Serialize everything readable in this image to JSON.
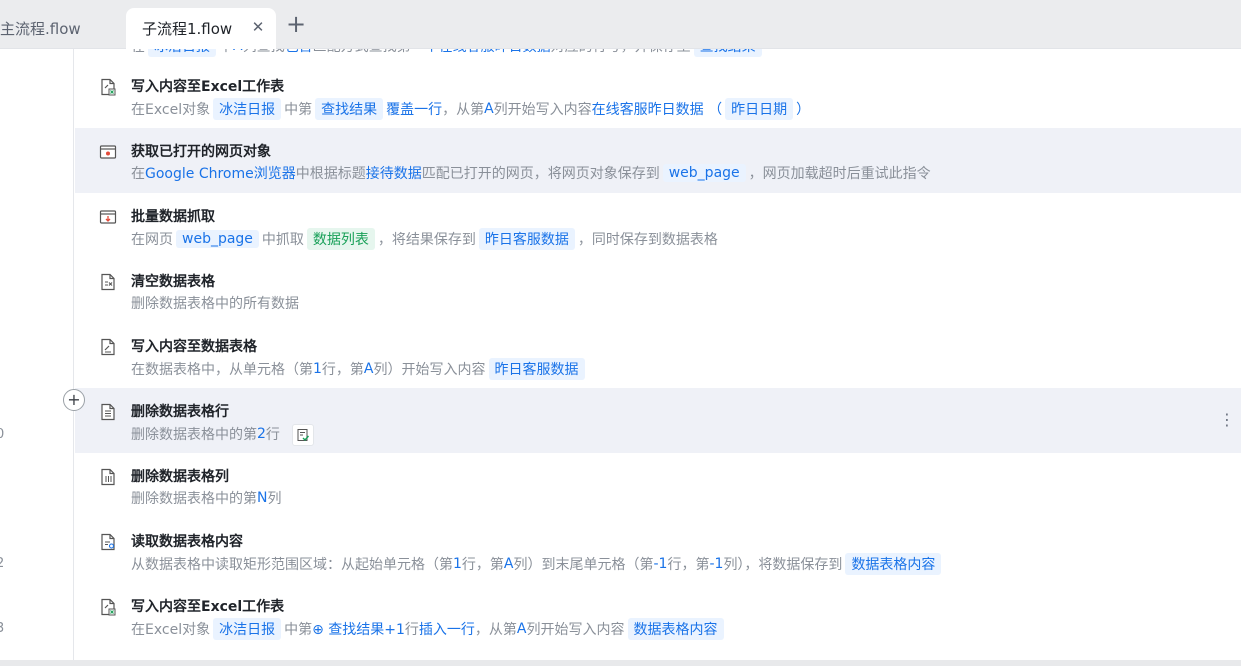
{
  "tabs": {
    "inactive_label": "主流程.flow",
    "active_label": "子流程1.flow",
    "close_glyph": "✕",
    "add_glyph": "+"
  },
  "gutter": {
    "line_numbers": [
      "0",
      "2",
      "3"
    ],
    "add_glyph": "+"
  },
  "steps": [
    {
      "title": "写入内容至Excel工作表",
      "icon": "excel-write-icon",
      "desc": [
        {
          "t": "t",
          "v": "在Excel对象"
        },
        {
          "t": "chip",
          "v": "冰洁日报"
        },
        {
          "t": "t",
          "v": "中第"
        },
        {
          "t": "chip",
          "v": "查找结果"
        },
        {
          "t": "k",
          "v": "覆盖一行"
        },
        {
          "t": "t",
          "v": "，从第 "
        },
        {
          "t": "k",
          "v": "A"
        },
        {
          "t": "t",
          "v": " 列开始写入内容 "
        },
        {
          "t": "k",
          "v": "在线客服昨日数据 （"
        },
        {
          "t": "chip",
          "v": "昨日日期"
        },
        {
          "t": "k",
          "v": "）"
        }
      ]
    },
    {
      "title": "获取已打开的网页对象",
      "icon": "browser-window-icon",
      "highlight": true,
      "desc": [
        {
          "t": "t",
          "v": "在 "
        },
        {
          "t": "k",
          "v": "Google Chrome浏览器"
        },
        {
          "t": "t",
          "v": " 中根据标题 "
        },
        {
          "t": "k",
          "v": "接待数据"
        },
        {
          "t": "t",
          "v": " 匹配已打开的网页，将网页对象保存到"
        },
        {
          "t": "chip",
          "v": " web_page "
        },
        {
          "t": "t",
          "v": "，网页加载超时后重试此指令"
        }
      ]
    },
    {
      "title": "批量数据抓取",
      "icon": "data-scrape-icon",
      "desc": [
        {
          "t": "t",
          "v": "在网页"
        },
        {
          "t": "chip",
          "v": " web_page "
        },
        {
          "t": "t",
          "v": "中抓取"
        },
        {
          "t": "chip-g",
          "v": "数据列表"
        },
        {
          "t": "t",
          "v": "，将结果保存到"
        },
        {
          "t": "chip",
          "v": "昨日客服数据"
        },
        {
          "t": "t",
          "v": "，同时保存到数据表格"
        }
      ]
    },
    {
      "title": "清空数据表格",
      "icon": "table-clear-icon",
      "desc": [
        {
          "t": "t",
          "v": "删除数据表格中的所有数据"
        }
      ]
    },
    {
      "title": "写入内容至数据表格",
      "icon": "table-write-icon",
      "desc": [
        {
          "t": "t",
          "v": "在数据表格中，从单元格（第 "
        },
        {
          "t": "k",
          "v": "1"
        },
        {
          "t": "t",
          "v": " 行，第 "
        },
        {
          "t": "k",
          "v": "A"
        },
        {
          "t": "t",
          "v": " 列）开始写入内容"
        },
        {
          "t": "chip",
          "v": "昨日客服数据"
        }
      ]
    },
    {
      "title": "删除数据表格行",
      "icon": "table-delete-row-icon",
      "highlight": true,
      "kebab": "⋮",
      "badge": true,
      "desc": [
        {
          "t": "t",
          "v": "删除数据表格中的第 "
        },
        {
          "t": "k",
          "v": "2"
        },
        {
          "t": "t",
          "v": " 行"
        }
      ]
    },
    {
      "title": "删除数据表格列",
      "icon": "table-delete-column-icon",
      "desc": [
        {
          "t": "t",
          "v": "删除数据表格中的第 "
        },
        {
          "t": "k",
          "v": "N"
        },
        {
          "t": "t",
          "v": " 列"
        }
      ]
    },
    {
      "title": "读取数据表格内容",
      "icon": "table-read-icon",
      "desc": [
        {
          "t": "t",
          "v": "从数据表格中读取矩形范围区域：从起始单元格（第 "
        },
        {
          "t": "k",
          "v": "1"
        },
        {
          "t": "t",
          "v": " 行，第 "
        },
        {
          "t": "k",
          "v": "A"
        },
        {
          "t": "t",
          "v": " 列）到末尾单元格（第 "
        },
        {
          "t": "k",
          "v": "-1"
        },
        {
          "t": "t",
          "v": " 行，第 "
        },
        {
          "t": "k",
          "v": "-1"
        },
        {
          "t": "t",
          "v": " 列），将数据保存到"
        },
        {
          "t": "chip",
          "v": "数据表格内容"
        }
      ]
    },
    {
      "title": "写入内容至Excel工作表",
      "icon": "excel-write-icon",
      "desc": [
        {
          "t": "t",
          "v": "在Excel对象"
        },
        {
          "t": "chip",
          "v": "冰洁日报"
        },
        {
          "t": "t",
          "v": "中第 "
        },
        {
          "t": "k",
          "v": "⊕ 查找结果+1"
        },
        {
          "t": "t",
          "v": "行 "
        },
        {
          "t": "k",
          "v": "插入一行"
        },
        {
          "t": "t",
          "v": "，从第 "
        },
        {
          "t": "k",
          "v": "A"
        },
        {
          "t": "t",
          "v": " 列开始写入内容"
        },
        {
          "t": "chip",
          "v": "数据表格内容"
        }
      ]
    }
  ],
  "cut_step": {
    "desc": [
      {
        "t": "t",
        "v": "在"
      },
      {
        "t": "chip",
        "v": "冰洁日报"
      },
      {
        "t": "t",
        "v": "中"
      },
      {
        "t": "k",
        "v": "A"
      },
      {
        "t": "t",
        "v": "列查找"
      },
      {
        "t": "k",
        "v": "包含"
      },
      {
        "t": "t",
        "v": "匹配方式查找第"
      },
      {
        "t": "k",
        "v": "一个"
      },
      {
        "t": "k",
        "v": "在线客服昨日数据"
      },
      {
        "t": "t",
        "v": "对应的行号，并保存至"
      },
      {
        "t": "chip",
        "v": "查找结果"
      }
    ]
  },
  "colors": {
    "keyword": "#1a73e8",
    "chip_bg": "#eaf3ff",
    "chip_green": "#18a058",
    "highlight_row": "#eff1f7"
  }
}
